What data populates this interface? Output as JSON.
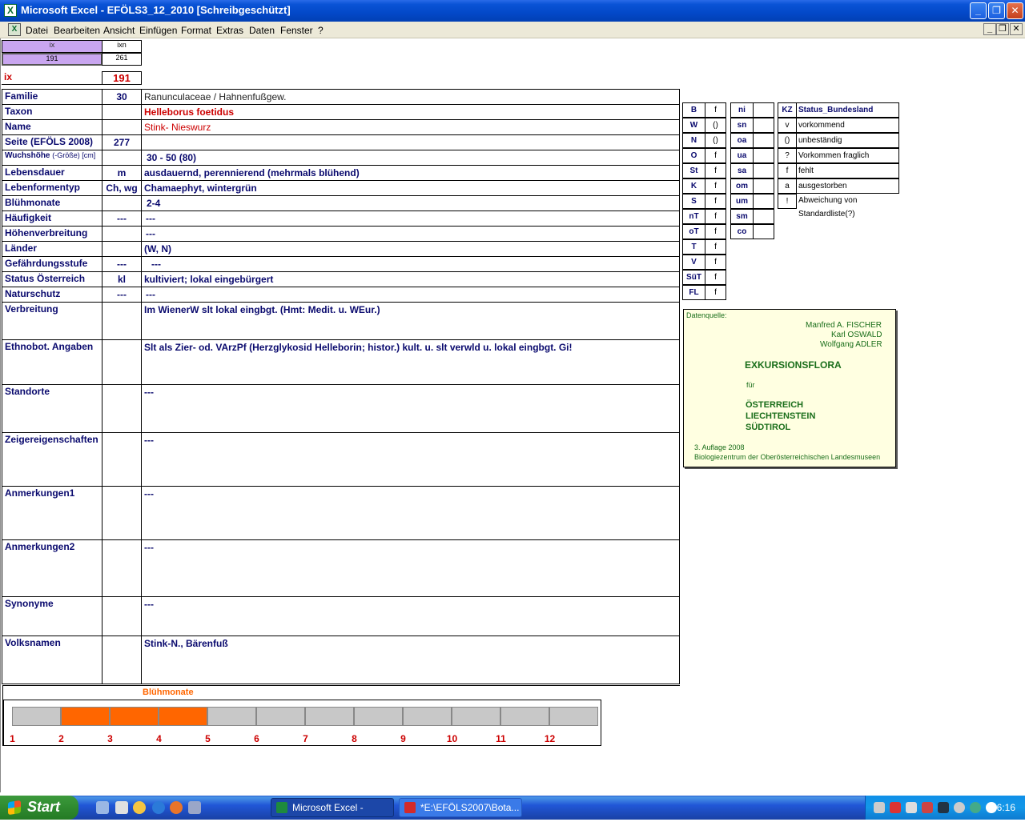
{
  "window": {
    "title": "Microsoft Excel - EFÖLS3_12_2010  [Schreibgeschützt]",
    "app_icon": "X"
  },
  "menu": {
    "items": [
      "Datei",
      "Bearbeiten",
      "Ansicht",
      "Einfügen",
      "Format",
      "Extras",
      "Daten",
      "Fenster",
      "?"
    ]
  },
  "index": {
    "ix_label": "ix",
    "ixn_label": "ixn",
    "ix_value": "191",
    "ixn_value": "261",
    "big_label": "ix",
    "big_value": "191"
  },
  "record": {
    "familie": {
      "label": "Familie",
      "code": "30",
      "value": "Ranunculaceae  /  Hahnenfußgew."
    },
    "taxon": {
      "label": "Taxon",
      "code": "",
      "value": "Helleborus foetidus"
    },
    "name": {
      "label": "Name",
      "code": "",
      "value": "Stink- Nieswurz"
    },
    "seite": {
      "label": "Seite (EFÖLS 2008)",
      "code": "277",
      "value": ""
    },
    "wuchshoehe": {
      "label": "Wuchshöhe",
      "label_suffix": "(-Größe) [cm]",
      "code": "",
      "value": "30 - 50 (80)"
    },
    "lebensdauer": {
      "label": "Lebensdauer",
      "code": "m",
      "value": "ausdauernd, perennierend (mehrmals blühend)"
    },
    "lebensformentyp": {
      "label": "Lebenformentyp",
      "code": "Ch, wg",
      "value": "Chamaephyt, wintergrün"
    },
    "bluehmonate": {
      "label": "Blühmonate",
      "code": "",
      "value": "2-4"
    },
    "haeufigkeit": {
      "label": "Häufigkeit",
      "code": "---",
      "value": "---"
    },
    "hoehenverbreitung": {
      "label": "Höhenverbreitung",
      "code": "",
      "value": "---"
    },
    "laender": {
      "label": "Länder",
      "code": "",
      "value": "(W, N)"
    },
    "gefaehrdungsstufe": {
      "label": "Gefährdungsstufe",
      "code": "---",
      "value": "---"
    },
    "status": {
      "label": "Status Österreich",
      "code": "kl",
      "value": "kultiviert; lokal eingebürgert"
    },
    "naturschutz": {
      "label": "Naturschutz",
      "code": "---",
      "value": "---"
    },
    "verbreitung": {
      "label": "Verbreitung",
      "value": "Im WienerW slt lokal eingbgt.  (Hmt: Medit. u. WEur.)"
    },
    "ethnobot": {
      "label": "Ethnobot. Angaben",
      "value": "Slt als Zier- od. VArzPf (Herzglykosid Helleborin; histor.) kult. u. slt verwld u. lokal eingbgt.   Gi!"
    },
    "standorte": {
      "label": "Standorte",
      "value": "---"
    },
    "zeiger": {
      "label": "Zeigereigenschaften",
      "value": "---"
    },
    "anm1": {
      "label": "Anmerkungen1",
      "value": "---"
    },
    "anm2": {
      "label": "Anmerkungen2",
      "value": "---"
    },
    "synonyme": {
      "label": "Synonyme",
      "value": "---"
    },
    "volksnamen": {
      "label": "Volksnamen",
      "value": "Stink-N., Bärenfuß"
    }
  },
  "states": [
    {
      "code": "B",
      "val": "f"
    },
    {
      "code": "W",
      "val": "()"
    },
    {
      "code": "N",
      "val": "()"
    },
    {
      "code": "O",
      "val": "f"
    },
    {
      "code": "St",
      "val": "f"
    },
    {
      "code": "K",
      "val": "f"
    },
    {
      "code": "S",
      "val": "f"
    },
    {
      "code": "nT",
      "val": "f"
    },
    {
      "code": "oT",
      "val": "f"
    },
    {
      "code": "T",
      "val": "f"
    },
    {
      "code": "V",
      "val": "f"
    },
    {
      "code": "SüT",
      "val": "f"
    },
    {
      "code": "FL",
      "val": "f"
    }
  ],
  "heights": [
    {
      "code": "ni",
      "val": ""
    },
    {
      "code": "sn",
      "val": ""
    },
    {
      "code": "oa",
      "val": ""
    },
    {
      "code": "ua",
      "val": ""
    },
    {
      "code": "sa",
      "val": ""
    },
    {
      "code": "om",
      "val": ""
    },
    {
      "code": "um",
      "val": ""
    },
    {
      "code": "sm",
      "val": ""
    },
    {
      "code": "co",
      "val": ""
    }
  ],
  "legend": {
    "header_kz": "KZ",
    "header_status": "Status_Bundesland",
    "rows": [
      {
        "kz": "v",
        "text": "vorkommend"
      },
      {
        "kz": "()",
        "text": "unbeständig"
      },
      {
        "kz": "?",
        "text": "Vorkommen fraglich"
      },
      {
        "kz": "f",
        "text": "fehlt"
      },
      {
        "kz": "a",
        "text": "ausgestorben"
      },
      {
        "kz": "!",
        "text": "Abweichung von Standardliste(?)"
      }
    ]
  },
  "source": {
    "heading": "Datenquelle:",
    "author1": "Manfred A. FISCHER",
    "author2": "Karl OSWALD",
    "author3": "Wolfgang ADLER",
    "book": "EXKURSIONSFLORA",
    "fuer": "für",
    "region1": "ÖSTERREICH",
    "region2": "LIECHTENSTEIN",
    "region3": "SÜDTIROL",
    "edition": "3. Auflage 2008",
    "publisher": "Biologiezentrum der Oberösterreichischen Landesmuseen",
    "text_color": "#1a6e1a"
  },
  "chart_data": {
    "type": "bar",
    "title": "Blühmonate",
    "categories": [
      "1",
      "2",
      "3",
      "4",
      "5",
      "6",
      "7",
      "8",
      "9",
      "10",
      "11",
      "12"
    ],
    "values": [
      0,
      1,
      1,
      1,
      0,
      0,
      0,
      0,
      0,
      0,
      0,
      0
    ],
    "on_color": "#ff6600",
    "off_color": "#c8c8c8"
  },
  "taskbar": {
    "start": "Start",
    "tasks": [
      "Microsoft Excel - EFÖ...",
      "*E:\\EFÖLS2007\\Bota..."
    ],
    "clock": "06:16"
  }
}
